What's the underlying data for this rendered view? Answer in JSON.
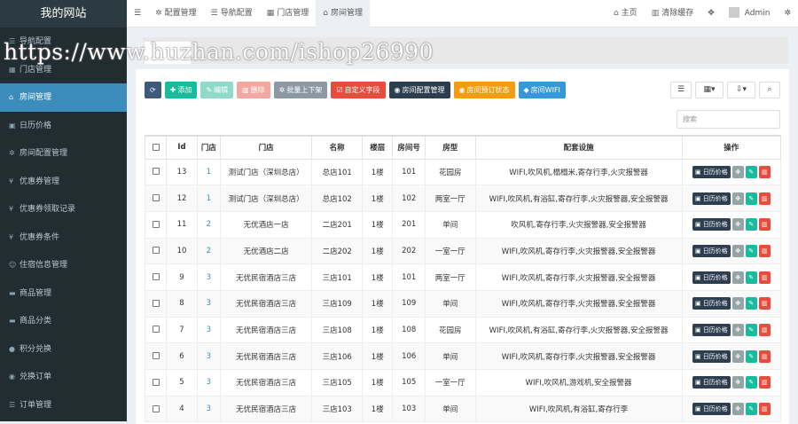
{
  "brand": "我的网站",
  "sidebar": {
    "items": [
      {
        "icon": "list-icon",
        "glyph": "☰",
        "label": "导航配置",
        "active": false
      },
      {
        "icon": "bank-icon",
        "glyph": "▦",
        "label": "门店管理",
        "active": false
      },
      {
        "icon": "home-icon",
        "glyph": "⌂",
        "label": "房间管理",
        "active": true
      },
      {
        "icon": "calendar-icon",
        "glyph": "▣",
        "label": "日历价格",
        "active": false
      },
      {
        "icon": "gear-icon",
        "glyph": "✲",
        "label": "房间配置管理",
        "active": false
      },
      {
        "icon": "yen-icon",
        "glyph": "¥",
        "label": "优惠券管理",
        "active": false
      },
      {
        "icon": "yen-icon",
        "glyph": "¥",
        "label": "优惠券领取记录",
        "active": false
      },
      {
        "icon": "yen-icon",
        "glyph": "¥",
        "label": "优惠券条件",
        "active": false
      },
      {
        "icon": "users-icon",
        "glyph": "☺",
        "label": "住宿信息管理",
        "active": false
      },
      {
        "icon": "cart-icon",
        "glyph": "▬",
        "label": "商品管理",
        "active": false
      },
      {
        "icon": "cart-icon",
        "glyph": "▬",
        "label": "商品分类",
        "active": false
      },
      {
        "icon": "coin-icon",
        "glyph": "●",
        "label": "积分兑换",
        "active": false
      },
      {
        "icon": "exchange-icon",
        "glyph": "◉",
        "label": "兑换订单",
        "active": false
      },
      {
        "icon": "list-icon",
        "glyph": "☰",
        "label": "订单管理",
        "active": false
      }
    ]
  },
  "topbar": {
    "menu_icon": "☰",
    "tabs": [
      {
        "icon": "gear-icon",
        "glyph": "✲",
        "label": "配置管理",
        "active": false
      },
      {
        "icon": "list-icon",
        "glyph": "☰",
        "label": "导航配置",
        "active": false
      },
      {
        "icon": "bank-icon",
        "glyph": "▦",
        "label": "门店管理",
        "active": false
      },
      {
        "icon": "home-icon",
        "glyph": "⌂",
        "label": "房间管理",
        "active": true
      }
    ],
    "home": "主页",
    "clear_cache": "清除缓存",
    "admin": "Admin"
  },
  "watermark": "https://www.huzhan.com/ishop26990",
  "toolbar": {
    "add": "添加",
    "edit": "编辑",
    "delete": "删除",
    "batch": "批量上下架",
    "custom_field": "自定义字段",
    "room_config": "房间配置管理",
    "room_status": "房间预订状态",
    "room_wifi": "房间WIFI"
  },
  "search": {
    "placeholder": "搜索"
  },
  "table": {
    "headers": [
      "Id",
      "门店",
      "门店",
      "名称",
      "楼层",
      "房间号",
      "房型",
      "配套设施",
      "操作"
    ],
    "calendar_label": "日历价格",
    "rows": [
      {
        "id": "13",
        "store_id": "1",
        "store": "测试门店（深圳总店）",
        "name": "总店101",
        "floor": "1楼",
        "room": "101",
        "type": "花园房",
        "facilities": "WIFI,吹风机,榻榻米,寄存行李,火灾报警器"
      },
      {
        "id": "12",
        "store_id": "1",
        "store": "测试门店（深圳总店）",
        "name": "总店102",
        "floor": "1楼",
        "room": "102",
        "type": "两室一厅",
        "facilities": "WIFI,吹风机,有浴缸,寄存行李,火灾报警器,安全报警器"
      },
      {
        "id": "11",
        "store_id": "2",
        "store": "无优酒店一店",
        "name": "二店201",
        "floor": "1楼",
        "room": "201",
        "type": "单间",
        "facilities": "吹风机,寄存行李,火灾报警器,安全报警器"
      },
      {
        "id": "10",
        "store_id": "2",
        "store": "无优酒店二店",
        "name": "二店202",
        "floor": "1楼",
        "room": "202",
        "type": "一室一厅",
        "facilities": "WIFI,吹风机,寄存行李,火灾报警器,安全报警器"
      },
      {
        "id": "9",
        "store_id": "3",
        "store": "无优民宿酒店三店",
        "name": "三店101",
        "floor": "1楼",
        "room": "101",
        "type": "两室一厅",
        "facilities": "WIFI,吹风机,寄存行李,火灾报警器,安全报警器"
      },
      {
        "id": "8",
        "store_id": "3",
        "store": "无优民宿酒店三店",
        "name": "三店109",
        "floor": "1楼",
        "room": "109",
        "type": "单间",
        "facilities": "WIFI,吹风机,寄存行李,火灾报警器,安全报警器"
      },
      {
        "id": "7",
        "store_id": "3",
        "store": "无优民宿酒店三店",
        "name": "三店108",
        "floor": "1楼",
        "room": "108",
        "type": "花园房",
        "facilities": "WIFI,吹风机,有浴缸,寄存行李,火灾报警器,安全报警器"
      },
      {
        "id": "6",
        "store_id": "3",
        "store": "无优民宿酒店三店",
        "name": "三店106",
        "floor": "1楼",
        "room": "106",
        "type": "单间",
        "facilities": "WIFI,吹风机,寄存行李,火灾报警器,安全报警器"
      },
      {
        "id": "5",
        "store_id": "3",
        "store": "无优民宿酒店三店",
        "name": "三店105",
        "floor": "1楼",
        "room": "105",
        "type": "一室一厅",
        "facilities": "WIFI,吹风机,游戏机,安全报警器"
      },
      {
        "id": "4",
        "store_id": "3",
        "store": "无优民宿酒店三店",
        "name": "三店103",
        "floor": "1楼",
        "room": "103",
        "type": "单间",
        "facilities": "WIFI,吹风机,有浴缸,寄存行李"
      }
    ]
  }
}
